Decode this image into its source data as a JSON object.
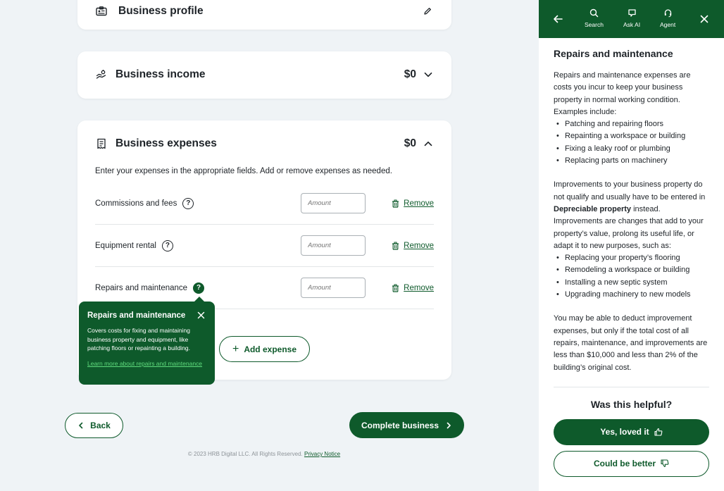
{
  "profile": {
    "title": "Business profile"
  },
  "income": {
    "title": "Business income",
    "amount": "$0"
  },
  "expenses": {
    "title": "Business expenses",
    "amount": "$0",
    "intro": "Enter your expenses in the appropriate fields. Add or remove expenses as needed.",
    "rows": [
      {
        "label": "Commissions and fees",
        "placeholder": "Amount",
        "remove": "Remove"
      },
      {
        "label": "Equipment rental",
        "placeholder": "Amount",
        "remove": "Remove"
      },
      {
        "label": "Repairs and maintenance",
        "placeholder": "Amount",
        "remove": "Remove"
      }
    ],
    "add_label": "Add expense"
  },
  "tooltip": {
    "title": "Repairs and maintenance",
    "body": "Covers costs for fixing and maintaining business property and equipment, like patching floors or repainting a building.",
    "link": "Learn more about repairs and maintenance"
  },
  "nav": {
    "back": "Back",
    "complete": "Complete business"
  },
  "footer": {
    "copyright": "© 2023 HRB Digital LLC. All Rights Reserved.",
    "privacy": "Privacy Notice"
  },
  "panel": {
    "tools": [
      {
        "label": "Search"
      },
      {
        "label": "Ask AI"
      },
      {
        "label": "Agent"
      }
    ],
    "title": "Repairs and maintenance",
    "para1": "Repairs and maintenance expenses are costs you incur to keep your business property in normal working condition. Examples include:",
    "list1": [
      "Patching and repairing floors",
      "Repainting a workspace or building",
      "Fixing a leaky roof or plumbing",
      "Replacing parts on machinery"
    ],
    "para2_a": "Improvements to your business property do not qualify and usually have to be entered in ",
    "para2_bold": "Depreciable property",
    "para2_b": " instead. Improvements are changes that add to your property’s value, prolong its useful life, or adapt it to new purposes, such as:",
    "list2": [
      "Replacing your property’s flooring",
      "Remodeling a workspace or building",
      "Installing a new septic system",
      "Upgrading machinery to new models"
    ],
    "para3": "You may be able to deduct improvement expenses, but only if the total cost of all repairs, maintenance, and improvements are less than $10,000 and less than 2% of the building’s original cost.",
    "helpful": "Was this helpful?",
    "yes": "Yes, loved it",
    "no": "Could be better"
  },
  "colors": {
    "brand": "#0e5a2b",
    "background": "#eff3f6",
    "link_on_dark": "#5fdc7d"
  }
}
